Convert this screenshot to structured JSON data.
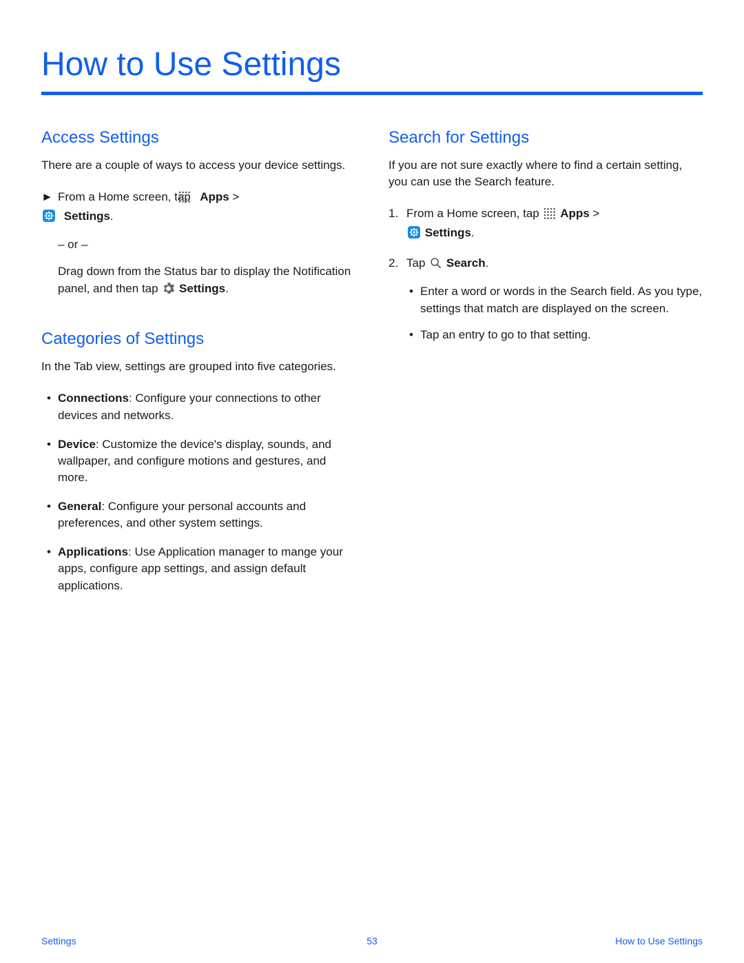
{
  "title": "How to Use Settings",
  "left": {
    "access": {
      "heading": "Access Settings",
      "intro": "There are a couple of ways to access your device settings.",
      "step_prefix": "From a Home screen, tap ",
      "apps_label": "Apps",
      "gt": " > ",
      "settings_label": "Settings",
      "period": ".",
      "or": "– or –",
      "drag_prefix": "Drag down from the Status bar to display the Notification panel, and then tap ",
      "drag_settings": "Settings",
      "drag_period": "."
    },
    "categories": {
      "heading": "Categories of Settings",
      "intro": "In the Tab view, settings are grouped into five categories.",
      "items": [
        {
          "name": "Connections",
          "desc": ": Configure your connections to other devices and networks."
        },
        {
          "name": "Device",
          "desc": ": Customize the device's display, sounds, and wallpaper, and configure motions and gestures, and more."
        },
        {
          "name": "General",
          "desc": ": Configure your personal accounts and preferences, and other system settings."
        },
        {
          "name": "Applications",
          "desc": ": Use Application manager to mange your apps, configure app settings, and assign default applications."
        }
      ]
    }
  },
  "right": {
    "search": {
      "heading": "Search for Settings",
      "intro": "If you are not sure exactly where to find a certain setting, you can use the Search feature.",
      "step1_prefix": "From a Home screen, tap ",
      "apps_label": "Apps",
      "gt": " > ",
      "settings_label": "Settings",
      "period": ".",
      "step2_prefix": "Tap ",
      "search_label": "Search",
      "step2_period": ".",
      "sub": [
        "Enter a word or words in the Search field. As you type, settings that match are displayed on the screen.",
        "Tap an entry to go to that setting."
      ]
    }
  },
  "footer": {
    "left": "Settings",
    "center": "53",
    "right": "How to Use Settings"
  }
}
